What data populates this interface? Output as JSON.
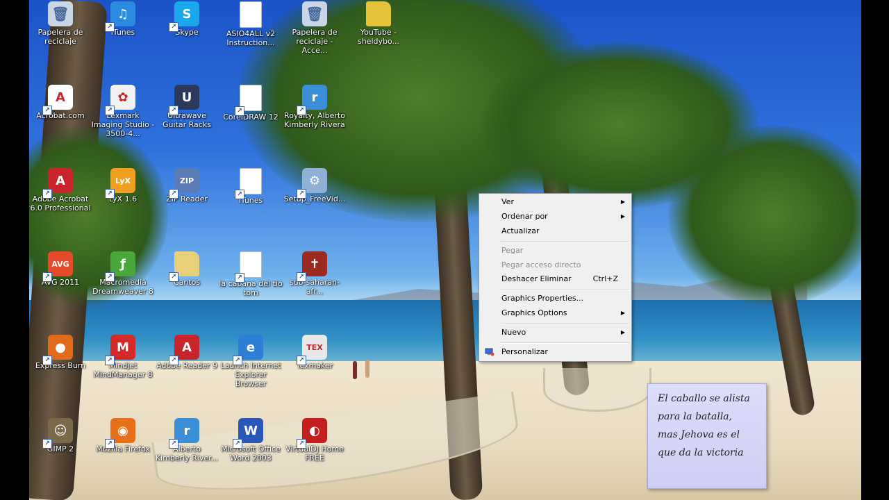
{
  "desktop": {
    "icons": [
      {
        "id": "papelera",
        "label": "Papelera de reciclaje",
        "icon": "recycle-bin-icon",
        "color": "#c9d6e8"
      },
      {
        "id": "itunes-1",
        "label": "iTunes",
        "icon": "itunes-icon",
        "color": "#2a8be0"
      },
      {
        "id": "skype",
        "label": "Skype",
        "icon": "skype-icon",
        "color": "#1aa7ec"
      },
      {
        "id": "asio",
        "label": "ASIO4ALL v2 Instruction...",
        "icon": "pdf-document-icon",
        "color": "#ffffff"
      },
      {
        "id": "papelera-acce",
        "label": "Papelera de reciclaje - Acce...",
        "icon": "recycle-bin-icon",
        "color": "#c9d6e8"
      },
      {
        "id": "youtube",
        "label": "YouTube - sheldybo...",
        "icon": "folder-film-icon",
        "color": "#e5c33a"
      },
      {
        "id": "acrobat-com",
        "label": "Acrobat.com",
        "icon": "acrobat-icon",
        "color": "#ffffff"
      },
      {
        "id": "lexmark",
        "label": "Lexmark Imaging Studio - 3500-4...",
        "icon": "lexmark-icon",
        "color": "#f2f2f2"
      },
      {
        "id": "ultrawave",
        "label": "Ultrawave Guitar Racks",
        "icon": "ultrawave-icon",
        "color": "#2b3a5a"
      },
      {
        "id": "coreldraw",
        "label": "CorelDRAW 12",
        "icon": "blank-document-icon",
        "color": "#ffffff"
      },
      {
        "id": "royalty",
        "label": "Royalty, Alberto Kimberly Rivera",
        "icon": "realplayer-icon",
        "color": "#3a8fd8"
      },
      {
        "id": "adobe-acrobat",
        "label": "Adobe Acrobat 6.0 Professional",
        "icon": "adobe-acrobat-icon",
        "color": "#c8242b"
      },
      {
        "id": "lyx",
        "label": "LyX 1.6",
        "icon": "lyx-icon",
        "color": "#f0a020"
      },
      {
        "id": "zip-reader",
        "label": "ZIP Reader",
        "icon": "zip-icon",
        "color": "#5a7bb3"
      },
      {
        "id": "itunes-2",
        "label": "iTunes",
        "icon": "blank-document-icon",
        "color": "#ffffff"
      },
      {
        "id": "setup-freevid",
        "label": "Setup_FreeVid...",
        "icon": "installer-icon",
        "color": "#8fb1d6"
      },
      {
        "id": "avg",
        "label": "AVG 2011",
        "icon": "avg-icon",
        "color": "#e34b2a"
      },
      {
        "id": "dreamweaver",
        "label": "Macromedia Dreamweaver 8",
        "icon": "dreamweaver-icon",
        "color": "#4aa83a"
      },
      {
        "id": "cantos",
        "label": "Cantos",
        "icon": "folder-icon",
        "color": "#e8cf7a"
      },
      {
        "id": "cabana",
        "label": "la cabana del tio tom",
        "icon": "pdf-document-icon",
        "color": "#ffffff"
      },
      {
        "id": "sub-saharan",
        "label": "sub-saharan-afr...",
        "icon": "pdf-book-icon",
        "color": "#9c2a20"
      },
      {
        "id": "express-burn",
        "label": "Express Burn",
        "icon": "express-burn-icon",
        "color": "#e06b1b"
      },
      {
        "id": "mindjet",
        "label": "Mindjet MindManager 8",
        "icon": "mindjet-icon",
        "color": "#d42a2a"
      },
      {
        "id": "adobe-reader",
        "label": "Adobe Reader 9",
        "icon": "adobe-reader-icon",
        "color": "#c8242b"
      },
      {
        "id": "launch-ie",
        "label": "Launch Internet Explorer Browser",
        "icon": "internet-explorer-icon",
        "color": "#2e7fd6"
      },
      {
        "id": "texmaker",
        "label": "Texmaker",
        "icon": "texmaker-icon",
        "color": "#e8e8e8"
      },
      {
        "id": "gimp",
        "label": "GIMP 2",
        "icon": "gimp-icon",
        "color": "#7a6a4a"
      },
      {
        "id": "firefox",
        "label": "Mozilla Firefox",
        "icon": "firefox-icon",
        "color": "#e8701a"
      },
      {
        "id": "alberto-kimberly",
        "label": "Alberto Kimberly River...",
        "icon": "realplayer-icon",
        "color": "#3a8fd8"
      },
      {
        "id": "word-2003",
        "label": "Microsoft Office Word 2003",
        "icon": "word-icon",
        "color": "#2a56b8"
      },
      {
        "id": "virtualdj",
        "label": "VirtualDJ Home FREE",
        "icon": "virtualdj-icon",
        "color": "#c41e1e"
      }
    ]
  },
  "context_menu": {
    "items": [
      {
        "label": "Ver",
        "submenu": true,
        "enabled": true
      },
      {
        "label": "Ordenar por",
        "submenu": true,
        "enabled": true
      },
      {
        "label": "Actualizar",
        "submenu": false,
        "enabled": true
      },
      {
        "label": "Pegar",
        "submenu": false,
        "enabled": false
      },
      {
        "label": "Pegar acceso directo",
        "submenu": false,
        "enabled": false
      },
      {
        "label": "Deshacer Eliminar",
        "shortcut": "Ctrl+Z",
        "submenu": false,
        "enabled": true
      },
      {
        "label": "Graphics Properties...",
        "submenu": false,
        "enabled": true
      },
      {
        "label": "Graphics Options",
        "submenu": true,
        "enabled": true
      },
      {
        "label": "Nuevo",
        "submenu": true,
        "enabled": true
      },
      {
        "label": "Personalizar",
        "submenu": false,
        "enabled": true,
        "icon": "personalize-icon"
      }
    ]
  },
  "sticky_note": {
    "lines": [
      "El caballo se alista",
      "para la batalla,",
      "mas Jehova es el",
      "que da la victoria"
    ]
  },
  "colors": {
    "menu_background": "#f0f0f0",
    "disabled_text": "#8d8d8d",
    "note_background": "#d6d6f8"
  }
}
